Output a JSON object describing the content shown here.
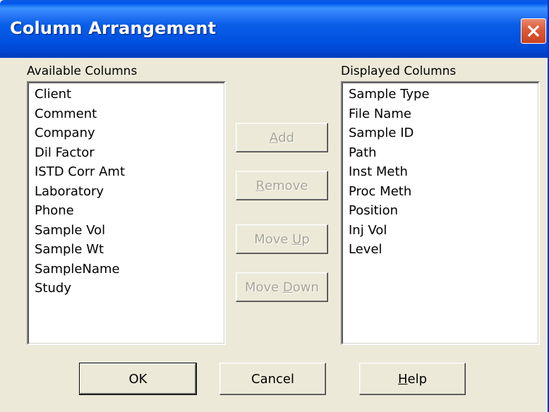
{
  "dialog": {
    "title": "Column Arrangement"
  },
  "available": {
    "label": "Available Columns",
    "items": [
      "Client",
      "Comment",
      "Company",
      "Dil Factor",
      "ISTD Corr Amt",
      "Laboratory",
      "Phone",
      "Sample Vol",
      "Sample Wt",
      "SampleName",
      "Study"
    ]
  },
  "displayed": {
    "label": "Displayed Columns",
    "items": [
      "Sample Type",
      "File Name",
      "Sample ID",
      "Path",
      "Inst Meth",
      "Proc Meth",
      "Position",
      "Inj Vol",
      "Level"
    ]
  },
  "buttons": {
    "add": {
      "pre": "",
      "key": "A",
      "post": "dd"
    },
    "remove": {
      "pre": "",
      "key": "R",
      "post": "emove"
    },
    "move_up": {
      "pre": "Move ",
      "key": "U",
      "post": "p"
    },
    "move_down": {
      "pre": "Move ",
      "key": "D",
      "post": "own"
    },
    "ok": "OK",
    "cancel": "Cancel",
    "help": {
      "pre": "",
      "key": "H",
      "post": "elp"
    }
  },
  "icons": {
    "close": "close-x-icon"
  },
  "colors": {
    "titlebar": "#0054e3",
    "dialog_bg": "#ece9d8",
    "close_button": "#dd5d3c",
    "disabled_text": "#a8a598"
  }
}
